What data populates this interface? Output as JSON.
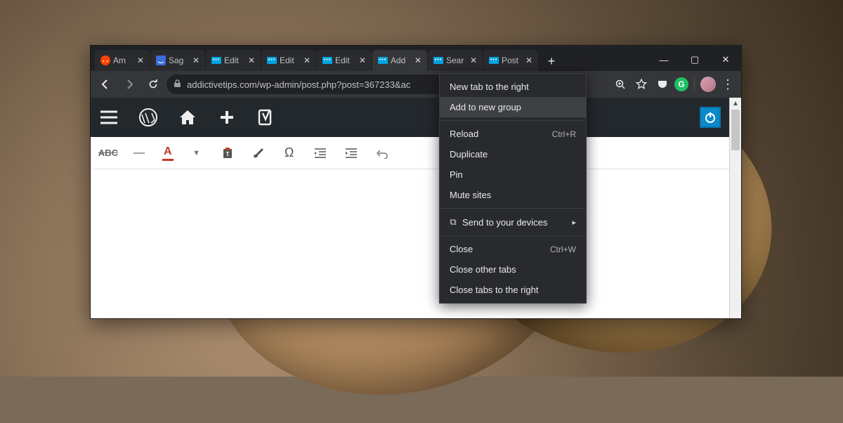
{
  "window": {
    "tabs": [
      {
        "fav": "reddit",
        "title": "Am"
      },
      {
        "fav": "sage",
        "title": "Sag"
      },
      {
        "fav": "dots",
        "title": "Edit"
      },
      {
        "fav": "dots",
        "title": "Edit"
      },
      {
        "fav": "dots",
        "title": "Edit"
      },
      {
        "fav": "dots",
        "title": "Add"
      },
      {
        "fav": "dots",
        "title": "Sear"
      },
      {
        "fav": "dots",
        "title": "Post"
      }
    ],
    "controls": {
      "min": "—",
      "max": "▢",
      "close": "✕"
    }
  },
  "toolbar": {
    "url": "addictivetips.com/wp-admin/post.php?post=367233&ac",
    "grammarly": "G"
  },
  "editor": {
    "abc": "ABC",
    "a": "A",
    "omega": "Ω"
  },
  "context_menu": {
    "new_tab_right": "New tab to the right",
    "add_new_group": "Add to new group",
    "reload": "Reload",
    "reload_sc": "Ctrl+R",
    "duplicate": "Duplicate",
    "pin": "Pin",
    "mute": "Mute sites",
    "send": "Send to your devices",
    "close": "Close",
    "close_sc": "Ctrl+W",
    "close_other": "Close other tabs",
    "close_right": "Close tabs to the right"
  }
}
